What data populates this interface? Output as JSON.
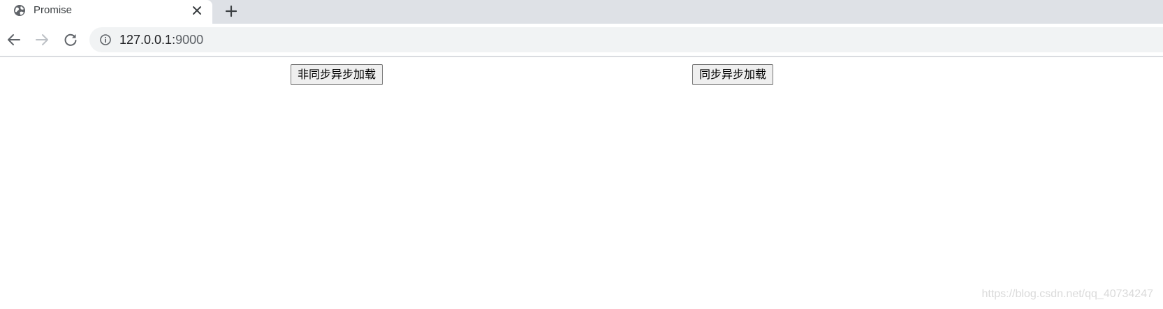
{
  "tab": {
    "title": "Promise",
    "favicon": "globe-icon"
  },
  "address_bar": {
    "host": "127.0.0.1:",
    "port": "9000"
  },
  "page": {
    "buttons": [
      {
        "label": "非同步异步加载"
      },
      {
        "label": "同步异步加载"
      }
    ],
    "watermark": "https://blog.csdn.net/qq_40734247"
  },
  "colors": {
    "tab_strip": "#dee1e6",
    "omnibox": "#f1f3f4",
    "icon": "#5f6368",
    "button_bg": "#efefef",
    "button_border": "#767676"
  }
}
